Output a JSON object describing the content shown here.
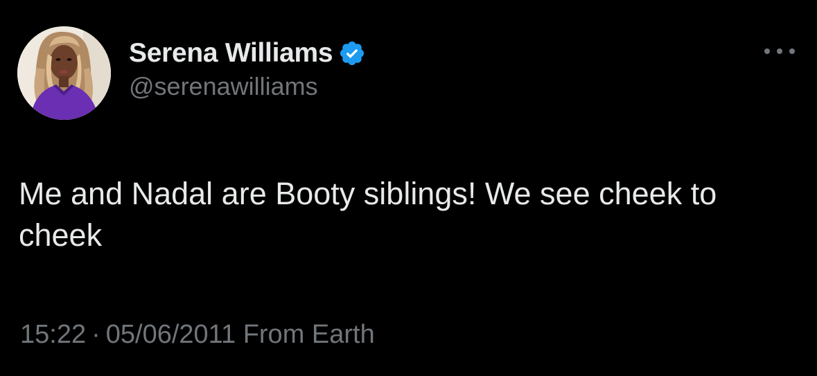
{
  "author": {
    "display_name": "Serena Williams",
    "handle": "@serenawilliams",
    "verified": true,
    "verified_color": "#1d9bf0"
  },
  "tweet": {
    "text": "Me and Nadal are Booty siblings! We see cheek to cheek"
  },
  "meta": {
    "time": "15:22",
    "separator": "·",
    "date": "05/06/2011",
    "source": "From Earth"
  },
  "icons": {
    "more": "more-horizontal-icon",
    "verified": "verified-badge-icon"
  },
  "colors": {
    "background": "#000000",
    "primary_text": "#e7e9ea",
    "secondary_text": "#71767b"
  }
}
